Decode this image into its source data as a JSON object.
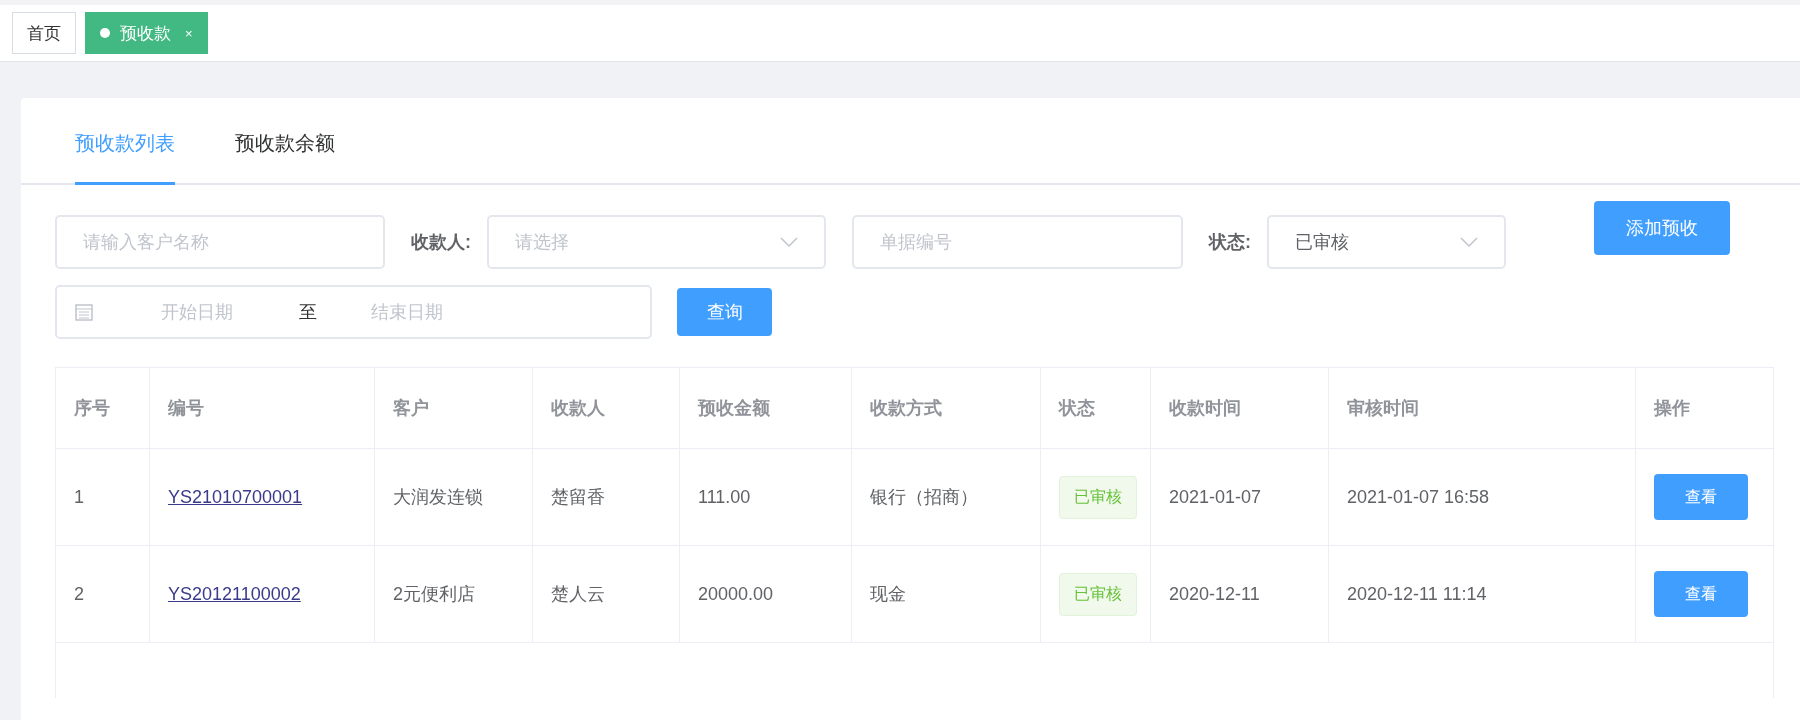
{
  "page_tabs": [
    {
      "label": "首页",
      "selected": false
    },
    {
      "label": "预收款",
      "selected": true,
      "close": "×"
    }
  ],
  "section_tabs": [
    {
      "label": "预收款列表",
      "selected": true
    },
    {
      "label": "预收款余额",
      "selected": false
    }
  ],
  "filters": {
    "customer": {
      "placeholder": "请输入客户名称"
    },
    "payee": {
      "label": "收款人:",
      "placeholder": "请选择"
    },
    "document_no": {
      "placeholder": "单据编号"
    },
    "status": {
      "label": "状态:",
      "value": "已审核"
    },
    "add_button": "添加预收",
    "date_range": {
      "start_placeholder": "开始日期",
      "separator": "至",
      "end_placeholder": "结束日期"
    },
    "query_button": "查询"
  },
  "table": {
    "columns": [
      "序号",
      "编号",
      "客户",
      "收款人",
      "预收金额",
      "收款方式",
      "状态",
      "收款时间",
      "审核时间",
      "操作"
    ],
    "rows": [
      {
        "index": "1",
        "number": "YS21010700001",
        "customer": "大润发连锁",
        "payee": "楚留香",
        "amount": "111.00",
        "method": "银行（招商）",
        "status": "已审核",
        "received": "2021-01-07",
        "audited": "2021-01-07 16:58",
        "action": "查看"
      },
      {
        "index": "2",
        "number": "YS20121100002",
        "customer": "2元便利店",
        "payee": "楚人云",
        "amount": "20000.00",
        "method": "现金",
        "status": "已审核",
        "received": "2020-12-11",
        "audited": "2020-12-11 11:14",
        "action": "查看"
      }
    ]
  }
}
